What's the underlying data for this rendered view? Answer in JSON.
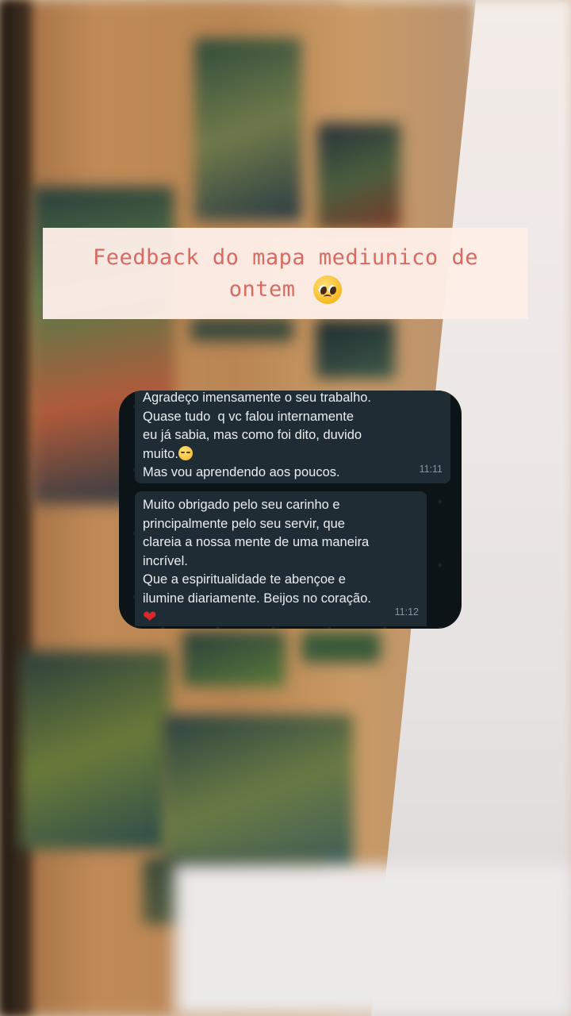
{
  "caption": {
    "line1": "Feedback do mapa mediunico de",
    "line2": "ontem",
    "emoji": "pleading-face"
  },
  "chat": {
    "messages": [
      {
        "lines": [
          "Agradeço imensamente o seu trabalho.",
          "Quase tudo  q vc falou internamente",
          "eu já sabia, mas como foi dito, duvido",
          "muito.",
          "Mas vou aprendendo aos poucos."
        ],
        "emoji": "pensive-face",
        "time": "11:11"
      },
      {
        "lines": [
          "Muito obrigado pelo seu carinho e",
          "principalmente pelo seu servir, que",
          "clareia a nossa mente de uma maneira",
          "incrível.",
          "Que a espiritualidade te abençoe e",
          "ilumine diariamente. Beijos no coração."
        ],
        "emoji": "red-heart",
        "heart_glyph": "❤",
        "time": "11:12"
      }
    ]
  },
  "colors": {
    "caption_bg": "#fdeee8",
    "caption_text": "#d86a62",
    "chat_bg": "#0d1417",
    "bubble_bg": "#202c33",
    "bubble_text": "#e9edef",
    "time_text": "#8696a0"
  }
}
